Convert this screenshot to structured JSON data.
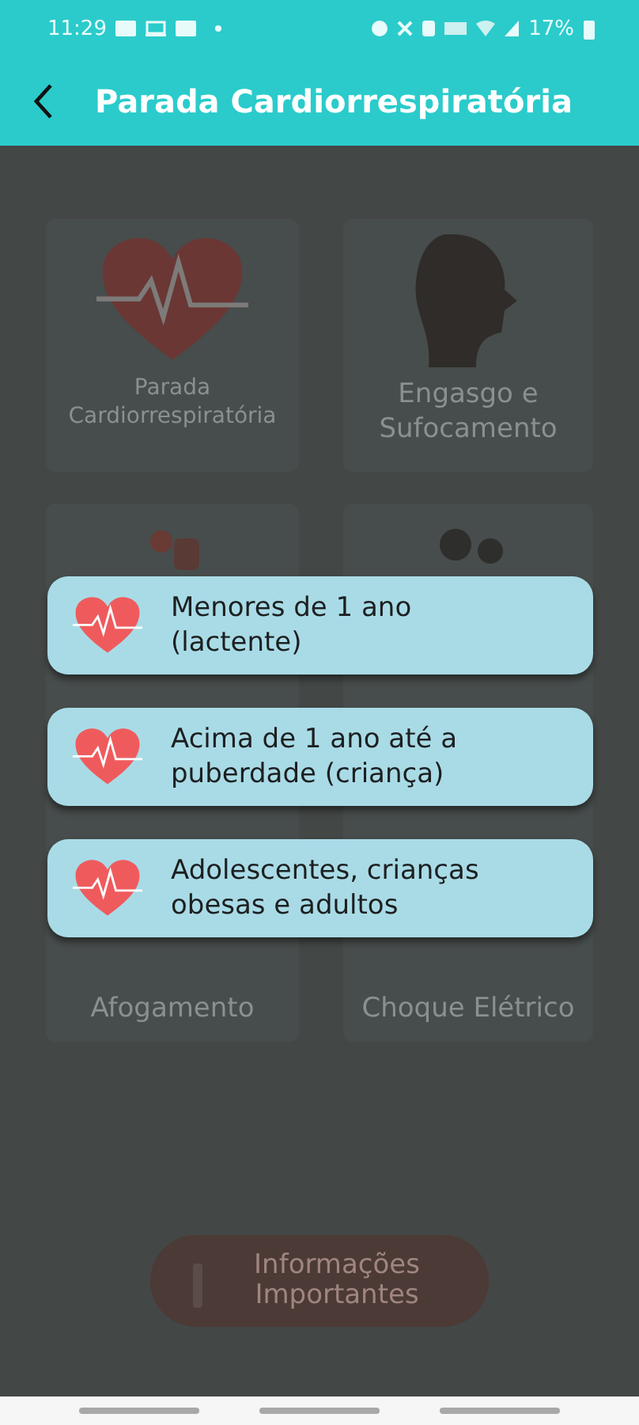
{
  "status_bar": {
    "time": "11:29",
    "battery": "17%"
  },
  "app_bar": {
    "title": "Parada Cardiorrespiratória"
  },
  "cards": [
    {
      "label": "Parada Cardiorrespiratória",
      "kind": "heart"
    },
    {
      "label": "Engasgo e Sufocamento",
      "kind": "head"
    },
    {
      "label": "Afogamento",
      "kind": "swimmer"
    },
    {
      "label": "Choque Elétrico",
      "kind": "people"
    }
  ],
  "info_button": {
    "label": "Informações Importantes"
  },
  "dialog": {
    "options": [
      {
        "label": "Menores de 1 ano (lactente)"
      },
      {
        "label": "Acima de 1 ano até a puberdade (criança)"
      },
      {
        "label": "Adolescentes, crianças obesas e adultos"
      }
    ]
  }
}
